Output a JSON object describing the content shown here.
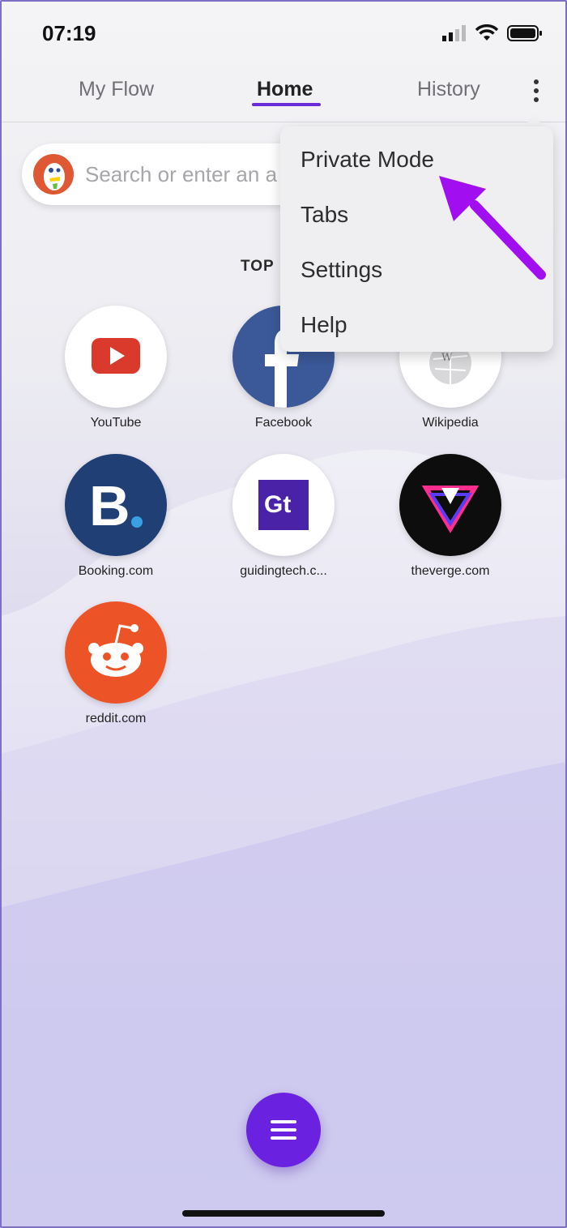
{
  "status_bar": {
    "time": "07:19",
    "icons": [
      "signal-icon",
      "wifi-icon",
      "battery-icon"
    ]
  },
  "nav": {
    "tabs": [
      {
        "label": "My Flow"
      },
      {
        "label": "Home",
        "active": true
      },
      {
        "label": "History"
      }
    ],
    "menu_button": "more-vert-icon",
    "accent_color": "#6a2bd9"
  },
  "search": {
    "placeholder": "Search or enter an address",
    "visible_text": "Search or enter an a",
    "engine_icon": "duckduckgo-icon"
  },
  "top_sites": {
    "title": "TOP",
    "items": [
      {
        "label": "YouTube",
        "color": "#d93a2b"
      },
      {
        "label": "Facebook",
        "color": "#3b5998"
      },
      {
        "label": "Wikipedia",
        "color": "#ffffff"
      },
      {
        "label": "Booking.com",
        "color": "#1f3f75"
      },
      {
        "label": "guidingtech.c...",
        "color": "#4a22a8"
      },
      {
        "label": "theverge.com",
        "color": "#0d0d0d"
      },
      {
        "label": "reddit.com",
        "color": "#ec5428"
      }
    ]
  },
  "menu": {
    "items": [
      "Private Mode",
      "Tabs",
      "Settings",
      "Help"
    ]
  },
  "annotation": {
    "arrow_color": "#a10ff0"
  },
  "bottom": {
    "fab_icon": "hamburger-menu-icon",
    "fab_color": "#6a22e0"
  }
}
